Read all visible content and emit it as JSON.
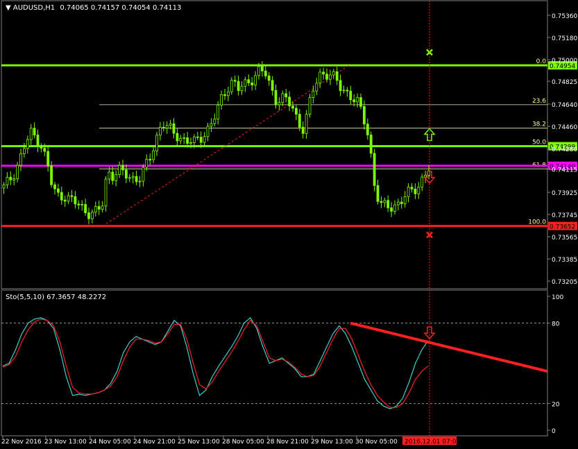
{
  "window": {
    "symbol_title": "AUDUSD,H1",
    "ohlc": "0.74065 0.74157 0.74054 0.74113"
  },
  "colors": {
    "background": "#000000",
    "bull_candle": "#7cfc00",
    "support_red": "#ff2020",
    "level_magenta": "#ff00ff",
    "fib_line": "#f0f0c0",
    "stoch_main": "#40d0d0",
    "stoch_signal": "#ff2020",
    "axis_text": "#ffffff",
    "fib_label": "#ffff80",
    "cursor_line": "#ff2020"
  },
  "chart_data": [
    {
      "type": "candlestick",
      "title": "AUDUSD,H1",
      "ylim": [
        0.732,
        0.7579
      ],
      "price_ticks": [
        "0.75360",
        "0.75180",
        "0.75000",
        "0.74825",
        "0.74640",
        "0.74460",
        "0.74280",
        "0.74115",
        "0.73925",
        "0.73745",
        "0.73565",
        "0.73385",
        "0.73205"
      ],
      "price_tick_values": [
        0.7536,
        0.7518,
        0.75,
        0.74825,
        0.7464,
        0.7446,
        0.7428,
        0.74115,
        0.73925,
        0.73745,
        0.73565,
        0.73385,
        0.73205
      ],
      "partial_top_tick": "0.75360",
      "horizontal_levels": [
        {
          "price": 0.74954,
          "label": "0.74954",
          "color": "#7cfc00"
        },
        {
          "price": 0.74299,
          "label": "0.74299",
          "color": "#7cfc00"
        },
        {
          "price": 0.7414,
          "label": "0.74140",
          "color": "#ff00ff"
        },
        {
          "price": 0.73652,
          "label": "0.73652",
          "color": "#ff2020"
        }
      ],
      "fibonacci": [
        {
          "level": "0.0",
          "price": 0.74954
        },
        {
          "level": "23.6",
          "price": 0.74635
        },
        {
          "level": "38.2",
          "price": 0.74445
        },
        {
          "level": "50.0",
          "price": 0.74299
        },
        {
          "level": "61.8",
          "price": 0.74115
        },
        {
          "level": "100.0",
          "price": 0.73652
        }
      ],
      "trend_line": {
        "from_price": 0.73652,
        "to_price": 0.74954
      },
      "close_path": [
        0.7396,
        0.7402,
        0.741,
        0.742,
        0.7432,
        0.744,
        0.7437,
        0.743,
        0.7415,
        0.7394,
        0.739,
        0.7391,
        0.7387,
        0.7384,
        0.7381,
        0.7378,
        0.7376,
        0.7376,
        0.738,
        0.741,
        0.7407,
        0.741,
        0.7407,
        0.7405,
        0.7404,
        0.7405,
        0.7412,
        0.7422,
        0.7437,
        0.745,
        0.7445,
        0.744,
        0.7438,
        0.7436,
        0.7434,
        0.7432,
        0.7436,
        0.7442,
        0.7448,
        0.7456,
        0.7468,
        0.7478,
        0.7484,
        0.7476,
        0.7478,
        0.7482,
        0.7488,
        0.7492,
        0.7488,
        0.7476,
        0.7468,
        0.747,
        0.7466,
        0.746,
        0.745,
        0.7445,
        0.7462,
        0.7478,
        0.7488,
        0.749,
        0.7488,
        0.7482,
        0.7476,
        0.7474,
        0.747,
        0.7464,
        0.7452,
        0.7438,
        0.74,
        0.7382,
        0.738,
        0.7381,
        0.7383,
        0.7386,
        0.739,
        0.7394,
        0.7398,
        0.7405,
        0.7411
      ],
      "markers": [
        {
          "type": "cross",
          "color": "#7cfc00",
          "price": 0.7506
        },
        {
          "type": "arrow-up",
          "color": "#7cfc00",
          "price": 0.7439
        },
        {
          "type": "arrow-down",
          "color": "#ff2020",
          "price": 0.7405
        },
        {
          "type": "cross",
          "color": "#ff2020",
          "price": 0.7358
        }
      ]
    },
    {
      "type": "line",
      "title": "Sto(5,5,10) 67.3657 48.2272",
      "ylim": [
        0,
        100
      ],
      "y_ticks": [
        "100",
        "80",
        "20",
        "0"
      ],
      "y_tick_values": [
        100,
        80,
        20,
        0
      ],
      "levels": [
        80,
        20
      ],
      "series": [
        {
          "values": [
            48,
            50,
            60,
            72,
            80,
            83,
            84,
            82,
            76,
            60,
            40,
            26,
            27,
            26,
            27,
            28,
            30,
            35,
            44,
            58,
            66,
            70,
            68,
            66,
            64,
            66,
            74,
            82,
            78,
            62,
            42,
            26,
            30,
            40,
            48,
            55,
            62,
            70,
            80,
            84,
            76,
            62,
            50,
            52,
            54,
            50,
            46,
            40,
            40,
            42,
            52,
            62,
            72,
            78,
            72,
            62,
            50,
            38,
            30,
            22,
            18,
            16,
            18,
            24,
            36,
            50,
            60,
            67
          ]
        },
        {
          "values": [
            47,
            49,
            55,
            66,
            75,
            81,
            83,
            82,
            78,
            66,
            48,
            32,
            28,
            27,
            27,
            28,
            30,
            33,
            40,
            52,
            62,
            68,
            68,
            67,
            65,
            66,
            72,
            79,
            79,
            68,
            50,
            34,
            31,
            36,
            44,
            51,
            58,
            66,
            75,
            82,
            78,
            66,
            54,
            52,
            53,
            51,
            47,
            42,
            40,
            41,
            48,
            58,
            68,
            76,
            76,
            68,
            56,
            44,
            34,
            26,
            21,
            17,
            17,
            20,
            28,
            38,
            44,
            48
          ]
        }
      ],
      "trend_line": {
        "from_value": 80,
        "to_value": 44
      },
      "marker": {
        "type": "arrow-down",
        "color": "#ff2020",
        "value": 73
      }
    }
  ],
  "time_axis": {
    "labels": [
      "22 Nov 2016",
      "23 Nov 13:00",
      "24 Nov 05:00",
      "24 Nov 21:00",
      "25 Nov 13:00",
      "28 Nov 05:00",
      "28 Nov 21:00",
      "29 Nov 13:00",
      "30 Nov 05:00"
    ],
    "cursor_label": "2016.12.01 07:00"
  }
}
